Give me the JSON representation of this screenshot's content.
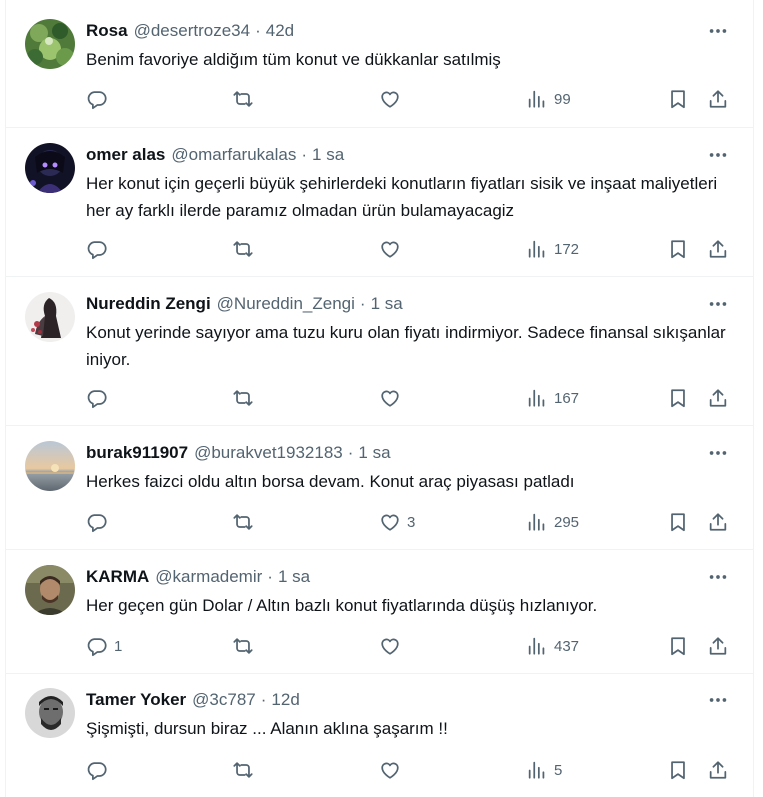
{
  "tweets": [
    {
      "name": "Rosa",
      "handle": "@desertroze34",
      "separator": "·",
      "time": "42d",
      "text": "Benim favoriye aldiğım tüm konut ve dükkanlar satılmiş",
      "reply_count": "",
      "retweet_count": "",
      "like_count": "",
      "view_count": "99"
    },
    {
      "name": "omer alas",
      "handle": "@omarfarukalas",
      "separator": "·",
      "time": "1 sa",
      "text": "Her konut için geçerli büyük  şehirlerdeki konutların fiyatları sisik ve inşaat maliyetleri  her ay farklı ilerde paramız olmadan ürün bulamayacagiz",
      "reply_count": "",
      "retweet_count": "",
      "like_count": "",
      "view_count": "172"
    },
    {
      "name": "Nureddin Zengi",
      "handle": "@Nureddin_Zengi",
      "separator": "·",
      "time": "1 sa",
      "text": "Konut yerinde sayıyor ama tuzu kuru olan fiyatı indirmiyor. Sadece finansal sıkışanlar iniyor.",
      "reply_count": "",
      "retweet_count": "",
      "like_count": "",
      "view_count": "167"
    },
    {
      "name": "burak911907",
      "handle": "@burakvet1932183",
      "separator": "·",
      "time": "1 sa",
      "text": "Herkes faizci oldu altın borsa devam. Konut araç piyasası patladı",
      "reply_count": "",
      "retweet_count": "",
      "like_count": "3",
      "view_count": "295"
    },
    {
      "name": "KARMA",
      "handle": "@karmademir",
      "separator": "·",
      "time": "1 sa",
      "text": "Her geçen gün Dolar / Altın bazlı  konut fiyatlarında düşüş hızlanıyor.",
      "reply_count": "1",
      "retweet_count": "",
      "like_count": "",
      "view_count": "437"
    },
    {
      "name": "Tamer Yoker",
      "handle": "@3c787",
      "separator": "·",
      "time": "12d",
      "text": "Şişmişti, dursun biraz ... Alanın aklına şaşarım !!",
      "reply_count": "",
      "retweet_count": "",
      "like_count": "",
      "view_count": "5"
    }
  ],
  "icons": {
    "more": "more-dots-icon",
    "reply": "reply-icon",
    "retweet": "retweet-icon",
    "like": "heart-icon",
    "views": "views-chart-icon",
    "bookmark": "bookmark-icon",
    "share": "share-icon"
  },
  "colors": {
    "text": "#0f1419",
    "secondary": "#536471",
    "divider": "#eff3f4"
  }
}
